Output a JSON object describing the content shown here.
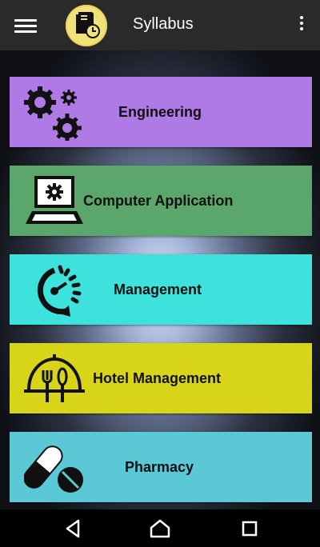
{
  "appbar": {
    "title": "Syllabus",
    "menu_icon": "hamburger-menu-icon",
    "more_icon": "overflow-dots-icon",
    "logo_icon": "syllabus-book-clock-logo"
  },
  "courses": [
    {
      "label": "Engineering",
      "icon": "gears-icon",
      "color": "#b07ae6"
    },
    {
      "label": "Computer Application",
      "icon": "laptop-gear-icon",
      "color": "#5aa66b"
    },
    {
      "label": "Management",
      "icon": "speedometer-icon",
      "color": "#3de2dd"
    },
    {
      "label": "Hotel Management",
      "icon": "fork-knife-dome-icon",
      "color": "#d8d418"
    },
    {
      "label": "Pharmacy",
      "icon": "pills-icon",
      "color": "#5bc8d6"
    }
  ],
  "navbar": {
    "back_icon": "back-triangle-icon",
    "home_icon": "home-icon",
    "recents_icon": "recents-square-icon"
  }
}
